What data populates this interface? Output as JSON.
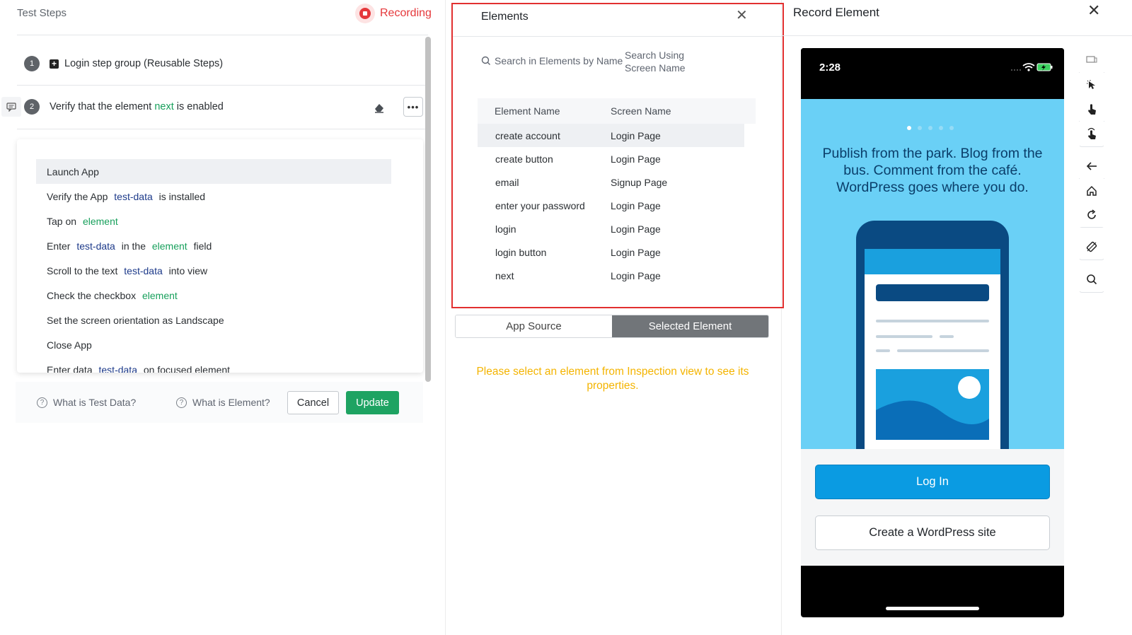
{
  "left": {
    "title": "Test Steps",
    "recording": "Recording",
    "steps": [
      {
        "num": "1",
        "text": "Login step group (Reusable Steps)"
      },
      {
        "num": "2",
        "pre": "Verify that the element ",
        "highlight": "next",
        "post": " is enabled"
      }
    ],
    "more_label": "•••",
    "dropdown": [
      {
        "t1": "Launch App"
      },
      {
        "t1": "Verify the App ",
        "v1": "test-data",
        "t2": " is installed"
      },
      {
        "t1": "Tap on ",
        "v1": "element"
      },
      {
        "t1": "Enter ",
        "v1": "test-data",
        "t2": " in the ",
        "v2": "element",
        "t3": " field"
      },
      {
        "t1": "Scroll to the text ",
        "v1": "test-data",
        "t2": " into view"
      },
      {
        "t1": "Check the checkbox ",
        "v1": "element"
      },
      {
        "t1": "Set the screen orientation as Landscape"
      },
      {
        "t1": "Close App"
      },
      {
        "t1": "Enter data ",
        "v1": "test-data",
        "t2": " on focused element"
      }
    ],
    "help_test_data": "What is Test Data?",
    "help_element": "What is Element?",
    "cancel": "Cancel",
    "update": "Update"
  },
  "elements": {
    "title": "Elements",
    "close": "✕",
    "search_placeholder": "Search in Elements by Name",
    "search_by_line1": "Search Using",
    "search_by_line2": "Screen Name",
    "headers": [
      "Element Name",
      "Screen Name"
    ],
    "rows": [
      [
        "create account",
        "Login Page"
      ],
      [
        "create button",
        "Login Page"
      ],
      [
        "email",
        "Signup Page"
      ],
      [
        "enter your password",
        "Login Page"
      ],
      [
        "login",
        "Login Page"
      ],
      [
        "login button",
        "Login Page"
      ],
      [
        "next",
        "Login Page"
      ]
    ],
    "tab_source": "App Source",
    "tab_selected": "Selected Element",
    "warning": "Please select an element from Inspection view to see its properties."
  },
  "record": {
    "title": "Record Element",
    "close": "✕",
    "time": "2:28",
    "headline": "Publish from the park. Blog from the bus. Comment from the café. WordPress goes where you do.",
    "login": "Log In",
    "create": "Create a WordPress site"
  },
  "colors": {
    "accent_green": "#1ea362",
    "recording_red": "#e5383b",
    "warning": "#f4b400",
    "wp_blue": "#0a9be2",
    "hero_bg": "#6ad0f6"
  }
}
